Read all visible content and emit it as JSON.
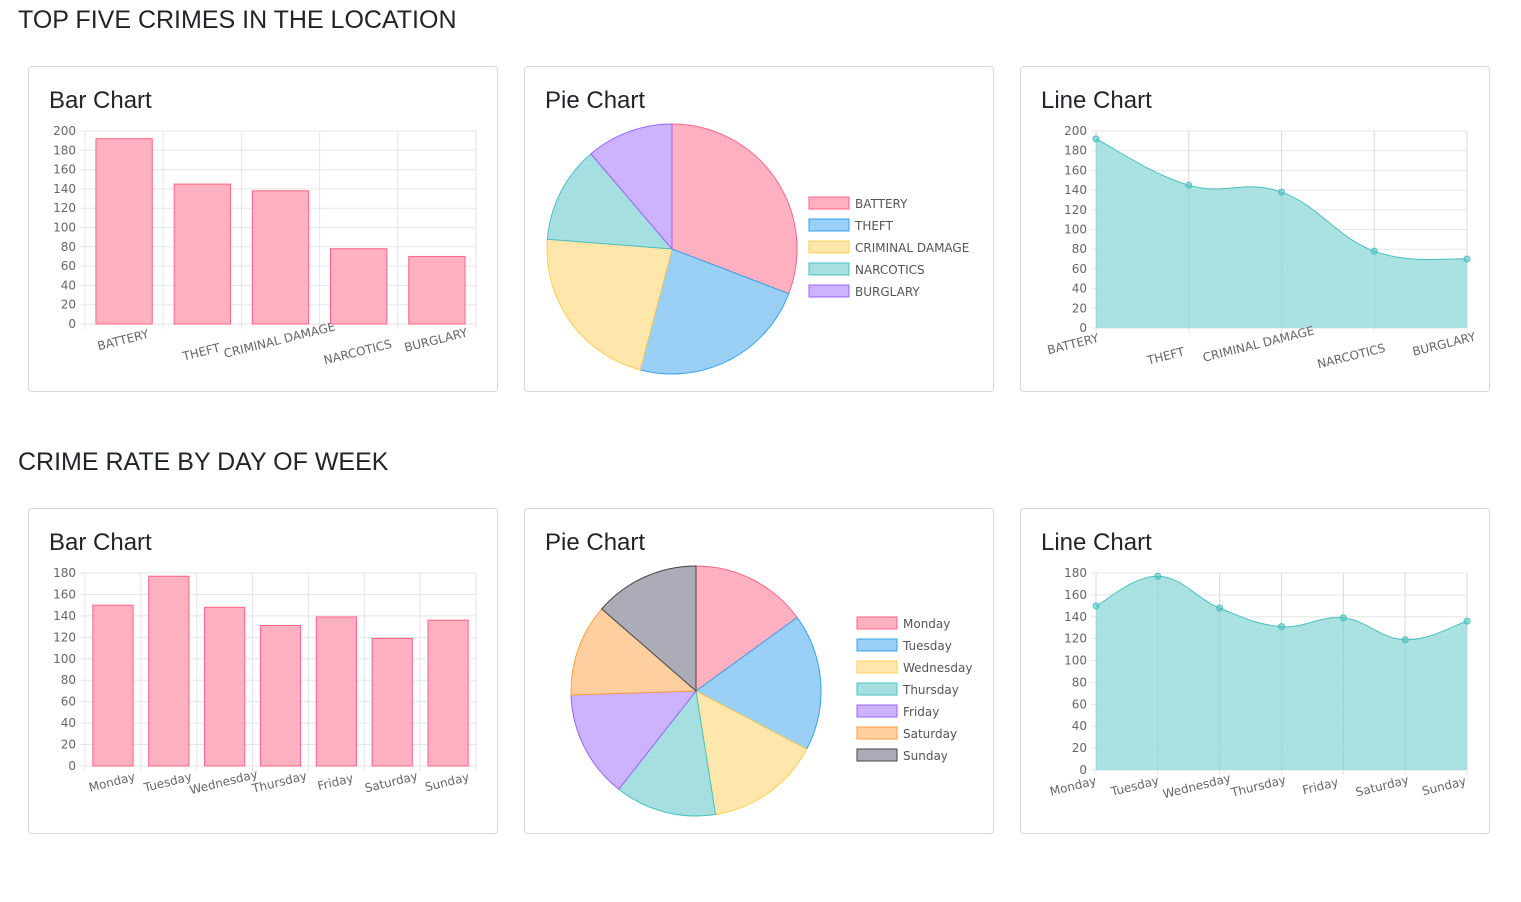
{
  "sections": [
    {
      "title": "TOP FIVE CRIMES IN THE LOCATION"
    },
    {
      "title": "CRIME RATE BY DAY OF WEEK"
    }
  ],
  "chart_titles": {
    "bar": "Bar Chart",
    "pie": "Pie Chart",
    "line": "Line Chart"
  },
  "palette": {
    "fills": [
      "#ffb1c1",
      "#9ad0f5",
      "#ffe6aa",
      "#a5dfdf",
      "#ccb2ff",
      "#ffcf9f",
      "#acacb9"
    ],
    "borders": [
      "#ff6384",
      "#36a2eb",
      "#ffcd56",
      "#4bc0c0",
      "#9966ff",
      "#ff9f40",
      "#444444"
    ],
    "bar_fill": "#ffb1c1",
    "bar_border": "#ff6384",
    "line_fill": "#a5dfdf",
    "line_border": "#4bc0c0",
    "grid": "#e5e5e5"
  },
  "chart_data": [
    {
      "type": "bar",
      "group": "crimes",
      "categories": [
        "BATTERY",
        "THEFT",
        "CRIMINAL DAMAGE",
        "NARCOTICS",
        "BURGLARY"
      ],
      "values": [
        192,
        145,
        138,
        78,
        70
      ],
      "ylim": [
        0,
        200
      ],
      "ystep": 20,
      "grid": true
    },
    {
      "type": "pie",
      "group": "crimes",
      "categories": [
        "BATTERY",
        "THEFT",
        "CRIMINAL DAMAGE",
        "NARCOTICS",
        "BURGLARY"
      ],
      "values": [
        192,
        145,
        138,
        78,
        70
      ],
      "legend": "right"
    },
    {
      "type": "area",
      "group": "crimes",
      "categories": [
        "BATTERY",
        "THEFT",
        "CRIMINAL DAMAGE",
        "NARCOTICS",
        "BURGLARY"
      ],
      "values": [
        192,
        145,
        138,
        78,
        70
      ],
      "ylim": [
        0,
        200
      ],
      "ystep": 20,
      "grid": true
    },
    {
      "type": "bar",
      "group": "days",
      "categories": [
        "Monday",
        "Tuesday",
        "Wednesday",
        "Thursday",
        "Friday",
        "Saturday",
        "Sunday"
      ],
      "values": [
        150,
        177,
        148,
        131,
        139,
        119,
        136
      ],
      "ylim": [
        0,
        180
      ],
      "ystep": 20,
      "grid": true
    },
    {
      "type": "pie",
      "group": "days",
      "categories": [
        "Monday",
        "Tuesday",
        "Wednesday",
        "Thursday",
        "Friday",
        "Saturday",
        "Sunday"
      ],
      "values": [
        150,
        177,
        148,
        131,
        139,
        119,
        136
      ],
      "legend": "right"
    },
    {
      "type": "area",
      "group": "days",
      "categories": [
        "Monday",
        "Tuesday",
        "Wednesday",
        "Thursday",
        "Friday",
        "Saturday",
        "Sunday"
      ],
      "values": [
        150,
        177,
        148,
        131,
        139,
        119,
        136
      ],
      "ylim": [
        0,
        180
      ],
      "ystep": 20,
      "grid": true
    }
  ]
}
